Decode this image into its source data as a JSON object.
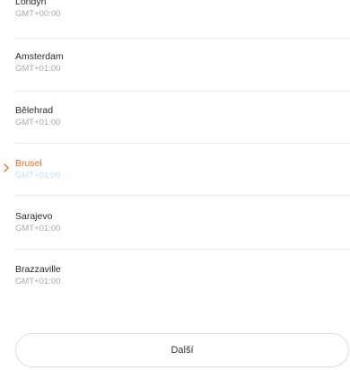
{
  "timezone_list": {
    "items": [
      {
        "name": "Londýn",
        "offset": "GMT+00:00",
        "selected": false
      },
      {
        "name": "Amsterdam",
        "offset": "GMT+01:00",
        "selected": false
      },
      {
        "name": "Bělehrad",
        "offset": "GMT+01:00",
        "selected": false
      },
      {
        "name": "Brusel",
        "offset": "GMT+01:00",
        "selected": true
      },
      {
        "name": "Sarajevo",
        "offset": "GMT+01:00",
        "selected": false
      },
      {
        "name": "Brazzaville",
        "offset": "GMT+01:00",
        "selected": false
      }
    ]
  },
  "colors": {
    "selected_name": "#f36b21",
    "selected_offset": "#bfe4fb",
    "chevron": "#f36b21"
  },
  "icons": {
    "selected_indicator": "chevron-right-icon"
  },
  "footer": {
    "next_label": "Další"
  }
}
